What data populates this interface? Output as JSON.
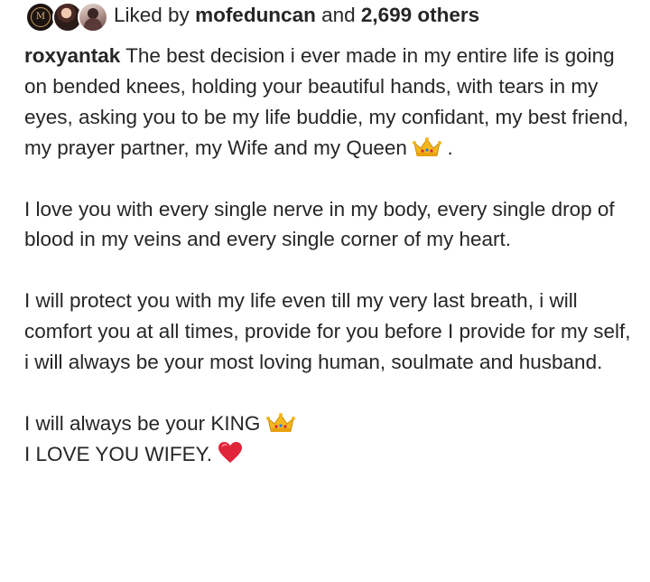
{
  "likes": {
    "prefix": "Liked by ",
    "user": "mofeduncan",
    "connector": " and ",
    "count": "2,699 others",
    "avatar_monogram": "M"
  },
  "post": {
    "username": "roxyantak",
    "paragraph1_main": " The best decision i ever made in my entire life is going on bended knees, holding your beautiful hands, with tears in my eyes, asking you to be my life buddie, my confidant, my best friend, my prayer partner, my Wife and my Queen",
    "paragraph1_end": " .",
    "paragraph2": "I love you with every single nerve in my body, every single drop of blood in my veins and every single corner of my heart.",
    "paragraph3": "I will protect you with my life even till my very last breath, i will comfort you at all times, provide for you before I provide for my self, i will always be your most loving human, soulmate and husband.",
    "paragraph4_line1": "I will always be your KING",
    "paragraph4_line2": "I LOVE YOU WIFEY. "
  },
  "icons": {
    "crown": "crown-emoji",
    "heart": "red-heart-emoji"
  },
  "colors": {
    "text": "#262626",
    "heart": "#e0243a",
    "crown": "#f5b71c"
  }
}
